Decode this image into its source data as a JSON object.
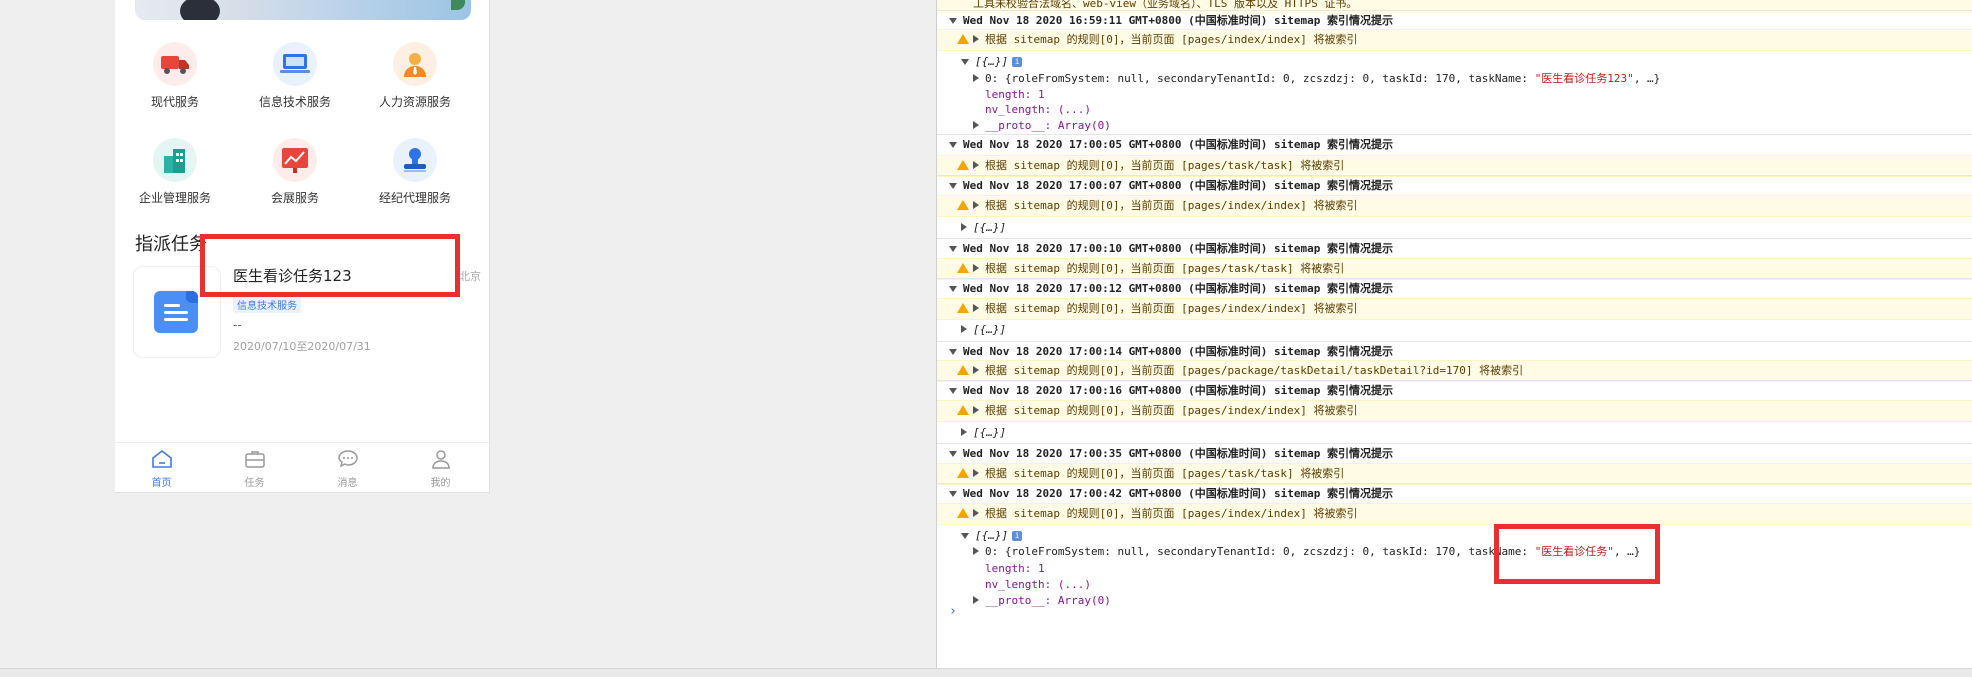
{
  "phone": {
    "services": [
      {
        "label": "现代服务",
        "icon": "truck-icon",
        "color": "#e8453c"
      },
      {
        "label": "信息技术服务",
        "icon": "laptop-icon",
        "color": "#2f74e6"
      },
      {
        "label": "人力资源服务",
        "icon": "person-icon",
        "color": "#f08a24"
      },
      {
        "label": "企业管理服务",
        "icon": "building-icon",
        "color": "#2bb3a3"
      },
      {
        "label": "会展服务",
        "icon": "chart-icon",
        "color": "#e8453c"
      },
      {
        "label": "经纪代理服务",
        "icon": "stamp-icon",
        "color": "#2f74e6"
      }
    ],
    "tasks_title": "指派任务",
    "task": {
      "name": "医生看诊任务123",
      "tag": "信息技术服务",
      "region": "北京",
      "desc": "--",
      "date": "2020/07/10至2020/07/31"
    },
    "tabs": [
      {
        "label": "首页",
        "icon": "home-icon"
      },
      {
        "label": "任务",
        "icon": "briefcase-icon"
      },
      {
        "label": "消息",
        "icon": "chat-icon"
      },
      {
        "label": "我的",
        "icon": "user-icon"
      }
    ]
  },
  "console": {
    "top_line": "工具未校验合法域名、web-view（业务域名）、TLS 版本以及 HTTPS 证书。",
    "entries": [
      {
        "type": "group",
        "text": "Wed Nov 18 2020 16:59:11 GMT+0800 (中国标准时间) sitemap 索引情况提示"
      },
      {
        "type": "warn",
        "text": "根据 sitemap 的规则[0]，当前页面 [pages/index/index] 将被索引"
      },
      {
        "type": "obj_open",
        "text": "[{…}]"
      },
      {
        "type": "obj_item",
        "text": "0: {roleFromSystem: null, secondaryTenantId: 0, zcszdzj: 0, taskId: 170, taskName: \"医生看诊任务123\", …}"
      },
      {
        "type": "obj_prop",
        "text": "length: 1"
      },
      {
        "type": "obj_prop",
        "text": "nv_length: (...)"
      },
      {
        "type": "obj_proto",
        "text": "__proto__: Array(0)"
      },
      {
        "type": "group",
        "text": "Wed Nov 18 2020 17:00:05 GMT+0800 (中国标准时间) sitemap 索引情况提示"
      },
      {
        "type": "warn",
        "text": "根据 sitemap 的规则[0]，当前页面 [pages/task/task] 将被索引"
      },
      {
        "type": "group",
        "text": "Wed Nov 18 2020 17:00:07 GMT+0800 (中国标准时间) sitemap 索引情况提示"
      },
      {
        "type": "warn",
        "text": "根据 sitemap 的规则[0]，当前页面 [pages/index/index] 将被索引"
      },
      {
        "type": "obj_closed",
        "text": "[{…}]"
      },
      {
        "type": "group",
        "text": "Wed Nov 18 2020 17:00:10 GMT+0800 (中国标准时间) sitemap 索引情况提示"
      },
      {
        "type": "warn",
        "text": "根据 sitemap 的规则[0]，当前页面 [pages/task/task] 将被索引"
      },
      {
        "type": "group",
        "text": "Wed Nov 18 2020 17:00:12 GMT+0800 (中国标准时间) sitemap 索引情况提示"
      },
      {
        "type": "warn",
        "text": "根据 sitemap 的规则[0]，当前页面 [pages/index/index] 将被索引"
      },
      {
        "type": "obj_closed",
        "text": "[{…}]"
      },
      {
        "type": "group",
        "text": "Wed Nov 18 2020 17:00:14 GMT+0800 (中国标准时间) sitemap 索引情况提示"
      },
      {
        "type": "warn",
        "text": "根据 sitemap 的规则[0]，当前页面 [pages/package/taskDetail/taskDetail?id=170] 将被索引"
      },
      {
        "type": "group",
        "text": "Wed Nov 18 2020 17:00:16 GMT+0800 (中国标准时间) sitemap 索引情况提示"
      },
      {
        "type": "warn",
        "text": "根据 sitemap 的规则[0]，当前页面 [pages/index/index] 将被索引"
      },
      {
        "type": "obj_closed",
        "text": "[{…}]"
      },
      {
        "type": "group",
        "text": "Wed Nov 18 2020 17:00:35 GMT+0800 (中国标准时间) sitemap 索引情况提示"
      },
      {
        "type": "warn",
        "text": "根据 sitemap 的规则[0]，当前页面 [pages/task/task] 将被索引"
      },
      {
        "type": "group",
        "text": "Wed Nov 18 2020 17:00:42 GMT+0800 (中国标准时间) sitemap 索引情况提示"
      },
      {
        "type": "warn",
        "text": "根据 sitemap 的规则[0]，当前页面 [pages/index/index] 将被索引"
      },
      {
        "type": "obj_open",
        "text": "[{…}]"
      },
      {
        "type": "obj_item",
        "text": "0: {roleFromSystem: null, secondaryTenantId: 0, zcszdzj: 0, taskId: 170, taskName: \"医生看诊任务\", …}"
      },
      {
        "type": "obj_prop",
        "text": "length: 1"
      },
      {
        "type": "obj_prop",
        "text": "nv_length: (...)"
      },
      {
        "type": "obj_proto",
        "text": "__proto__: Array(0)"
      }
    ],
    "prompt": "›"
  },
  "highlight_color": "#e8302f"
}
